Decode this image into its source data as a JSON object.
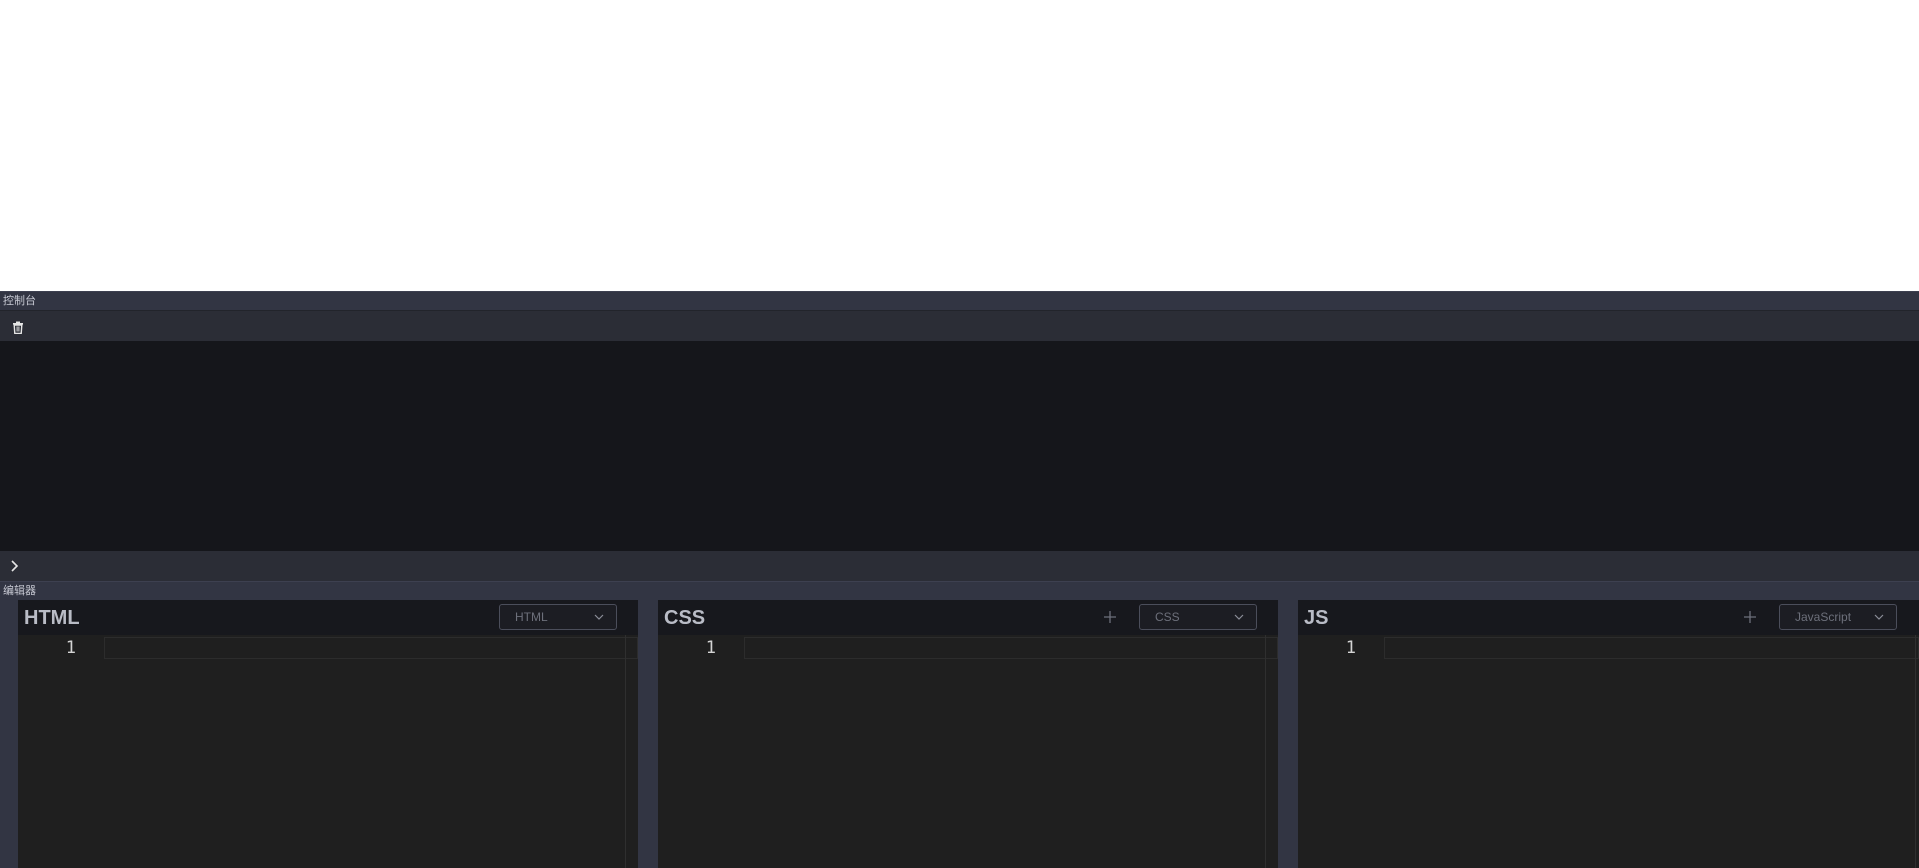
{
  "console": {
    "title": "控制台",
    "clear_icon": "trash-icon",
    "prompt_icon": "chevron-right-icon"
  },
  "editor": {
    "title": "编辑器",
    "panes": [
      {
        "title": "HTML",
        "language": "HTML",
        "line_number": "1",
        "has_add": false
      },
      {
        "title": "CSS",
        "language": "CSS",
        "line_number": "1",
        "has_add": true
      },
      {
        "title": "JS",
        "language": "JavaScript",
        "line_number": "1",
        "has_add": true
      }
    ]
  },
  "colors": {
    "header_bg": "#323543",
    "console_bg": "#15161b",
    "editor_bg": "#1f1f1f"
  }
}
